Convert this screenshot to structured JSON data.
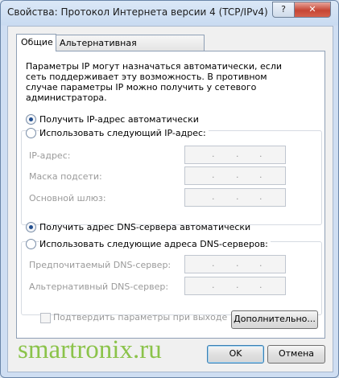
{
  "window": {
    "title": "Свойства: Протокол Интернета версии 4 (TCP/IPv4)",
    "help_label": "?",
    "close_label": "✕"
  },
  "tabs": [
    {
      "label": "Общие",
      "active": true
    },
    {
      "label": "Альтернативная конфигурация",
      "active": false
    }
  ],
  "info_text": "Параметры IP могут назначаться автоматически, если сеть поддерживает эту возможность. В противном случае параметры IP можно получить у сетевого администратора.",
  "ip": {
    "auto_label": "Получить IP-адрес автоматически",
    "manual_label": "Использовать следующий IP-адрес:",
    "selected": "auto",
    "fields": [
      {
        "label": "IP-адрес:",
        "value": ". . ."
      },
      {
        "label": "Маска подсети:",
        "value": ". . ."
      },
      {
        "label": "Основной шлюз:",
        "value": ". . ."
      }
    ]
  },
  "dns": {
    "auto_label": "Получить адрес DNS-сервера автоматически",
    "manual_label": "Использовать следующие адреса DNS-серверов:",
    "selected": "auto",
    "fields": [
      {
        "label": "Предпочитаемый DNS-сервер:",
        "value": ". . ."
      },
      {
        "label": "Альтернативный DNS-сервер:",
        "value": ". . ."
      }
    ]
  },
  "validate_label": "Подтвердить параметры при выходе",
  "buttons": {
    "advanced": "Дополнительно...",
    "ok": "OK",
    "cancel": "Отмена"
  },
  "watermark": "smartronix.ru",
  "colors": {
    "watermark": "#8bc34a",
    "radio_dot": "#234f8f"
  }
}
